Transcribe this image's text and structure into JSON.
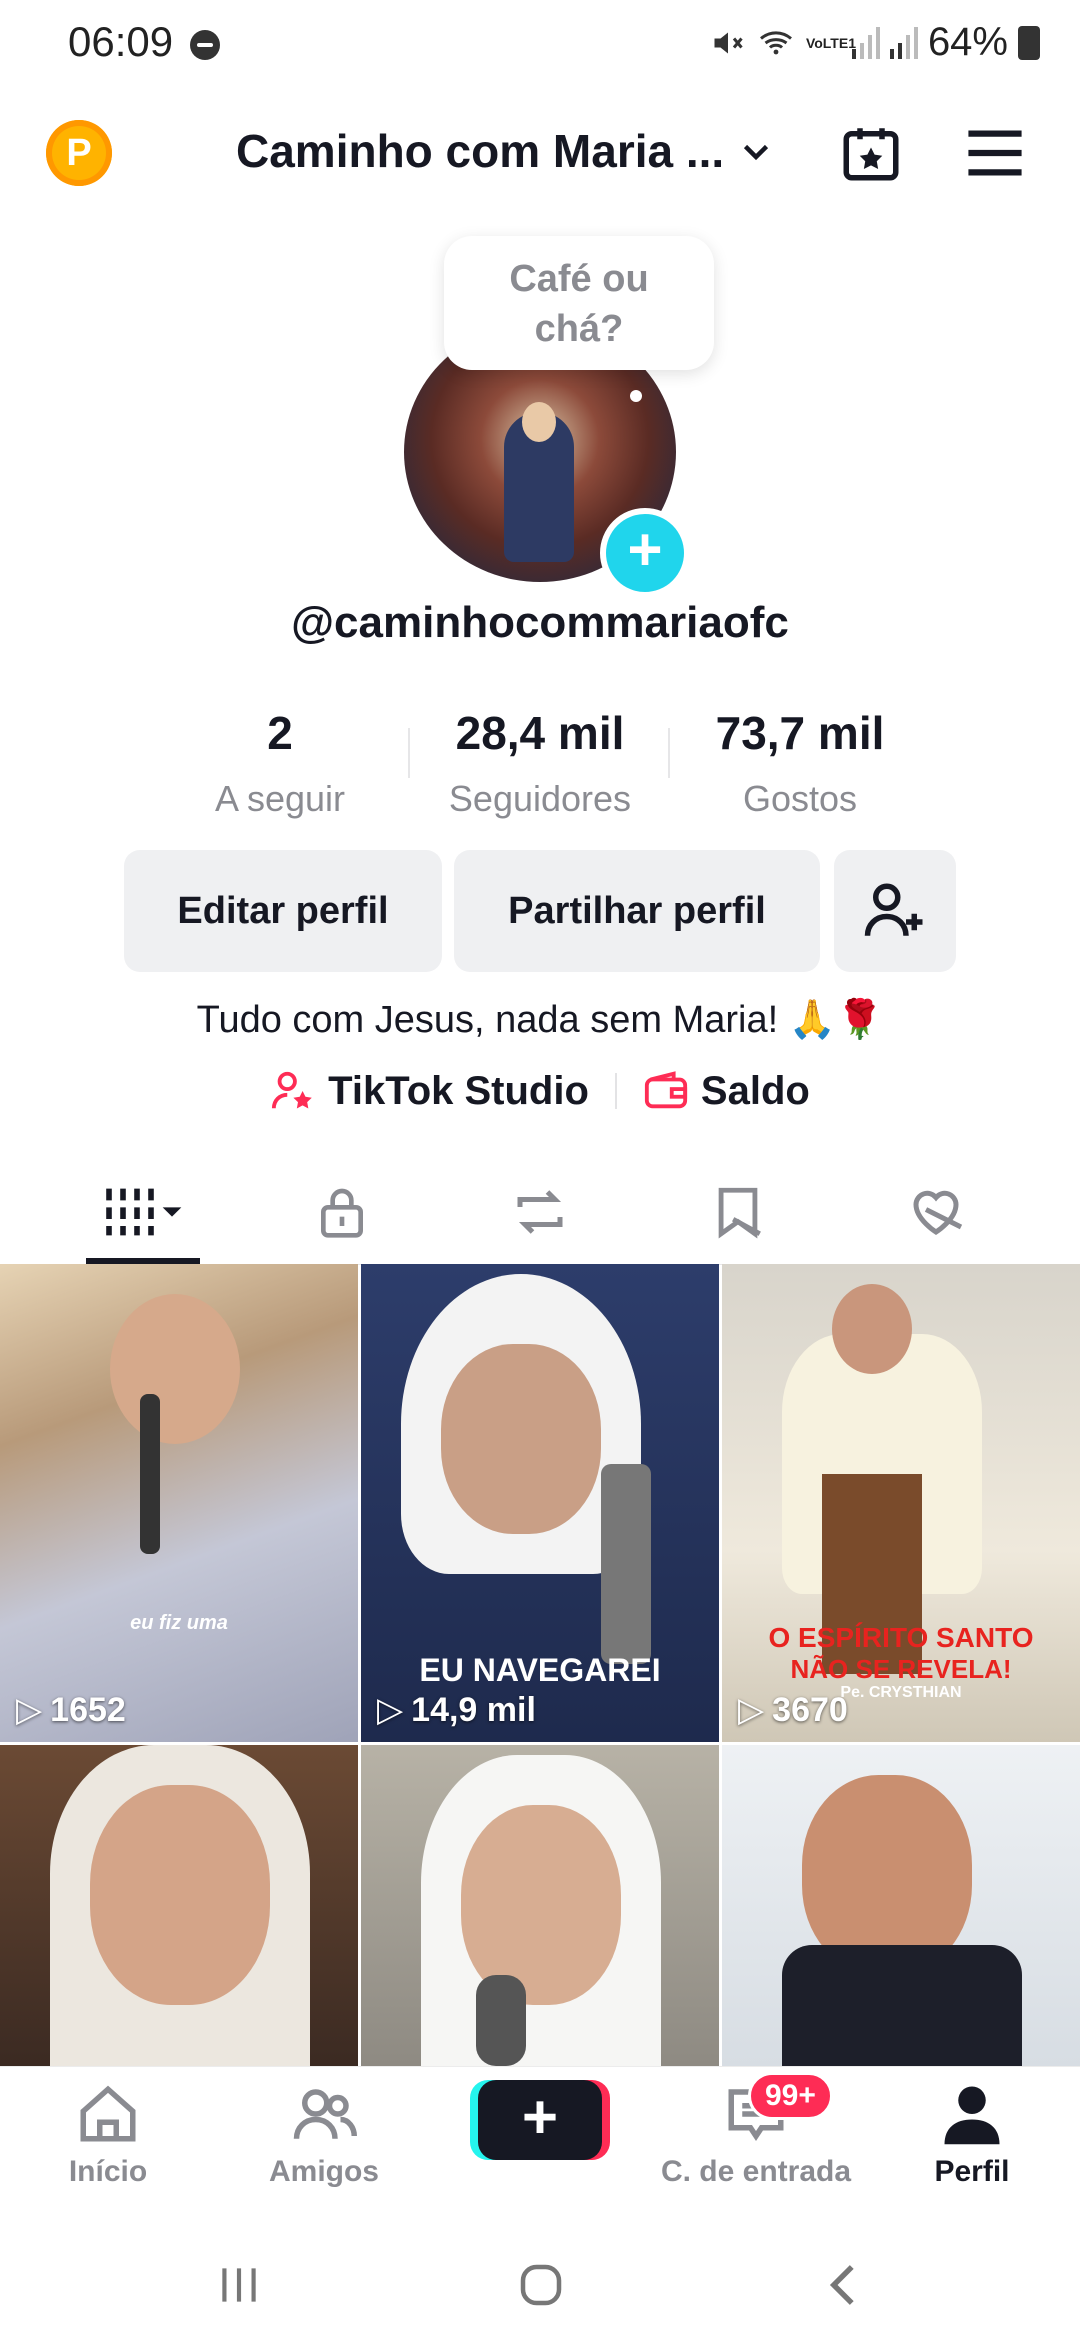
{
  "status_bar": {
    "time": "06:09",
    "battery": "64%",
    "network": "VoLTE1"
  },
  "header": {
    "coin_letter": "P",
    "account_name": "Caminho com Maria ..."
  },
  "profile": {
    "bubble_text_line1": "Café ou",
    "bubble_text_line2": "chá?",
    "username": "@caminhocommariaofc",
    "stats": [
      {
        "number": "2",
        "label": "A seguir"
      },
      {
        "number": "28,4 mil",
        "label": "Seguidores"
      },
      {
        "number": "73,7 mil",
        "label": "Gostos"
      }
    ],
    "edit_label": "Editar perfil",
    "share_label": "Partilhar perfil",
    "bio": "Tudo com Jesus, nada sem Maria! 🙏🌹",
    "studio_label": "TikTok Studio",
    "balance_label": "Saldo"
  },
  "videos": [
    {
      "views": "1652",
      "caption": "eu fiz uma"
    },
    {
      "views": "14,9 mil",
      "caption": "EU NAVEGAREI"
    },
    {
      "views": "3670",
      "caption_line1": "O ESPÍRITO SANTO",
      "caption_line2": "NÃO SE REVELA!",
      "caption_line3": "Pe. CRYSTHIAN"
    },
    {},
    {},
    {}
  ],
  "bottom_nav": {
    "home": "Início",
    "friends": "Amigos",
    "inbox": "C. de entrada",
    "inbox_badge": "99+",
    "profile": "Perfil"
  },
  "colors": {
    "accent": "#fe2c55",
    "cyan": "#20d5ec"
  }
}
